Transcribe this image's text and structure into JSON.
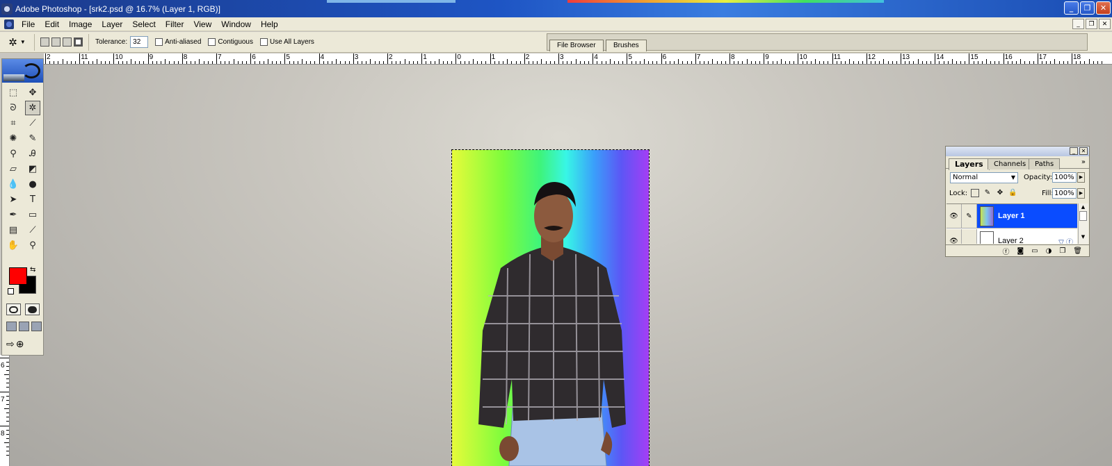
{
  "window": {
    "title": "Adobe Photoshop - [srk2.psd @ 16.7% (Layer 1, RGB)]",
    "controls": [
      "minimize",
      "restore",
      "close"
    ]
  },
  "menu": {
    "items": [
      "File",
      "Edit",
      "Image",
      "Layer",
      "Select",
      "Filter",
      "View",
      "Window",
      "Help"
    ]
  },
  "options": {
    "tool_icon": "magic-wand-icon",
    "tolerance_label": "Tolerance:",
    "tolerance_value": "32",
    "anti_aliased_label": "Anti-aliased",
    "contiguous_label": "Contiguous",
    "use_all_layers_label": "Use All Layers",
    "palette_well_tabs": [
      "File Browser",
      "Brushes"
    ]
  },
  "ruler": {
    "horizontal_labels": [
      "2",
      "11",
      "10",
      "9",
      "8",
      "7",
      "6",
      "5",
      "4",
      "3",
      "2",
      "1",
      "0",
      "1",
      "2",
      "3",
      "4",
      "5",
      "6",
      "7",
      "8",
      "9",
      "10",
      "11",
      "12",
      "13",
      "14",
      "15",
      "16",
      "17",
      "18"
    ],
    "vertical_labels": [
      "6",
      "7",
      "8"
    ]
  },
  "toolbox": {
    "foreground_color": "#ff0000",
    "background_color": "#000000",
    "tools": [
      {
        "name": "rectangular-marquee-tool",
        "glyph": "⬚"
      },
      {
        "name": "move-tool",
        "glyph": "✥"
      },
      {
        "name": "lasso-tool",
        "glyph": "ᘐ"
      },
      {
        "name": "magic-wand-tool",
        "glyph": "✲"
      },
      {
        "name": "crop-tool",
        "glyph": "⌗"
      },
      {
        "name": "slice-tool",
        "glyph": "⟋"
      },
      {
        "name": "healing-brush-tool",
        "glyph": "✺"
      },
      {
        "name": "brush-tool",
        "glyph": "✎"
      },
      {
        "name": "clone-stamp-tool",
        "glyph": "⚲"
      },
      {
        "name": "history-brush-tool",
        "glyph": "Ꭿ"
      },
      {
        "name": "eraser-tool",
        "glyph": "▱"
      },
      {
        "name": "paint-bucket-tool",
        "glyph": "◩"
      },
      {
        "name": "blur-tool",
        "glyph": "💧"
      },
      {
        "name": "dodge-tool",
        "glyph": "●"
      },
      {
        "name": "path-selection-tool",
        "glyph": "➤"
      },
      {
        "name": "type-tool",
        "glyph": "T"
      },
      {
        "name": "pen-tool",
        "glyph": "✒"
      },
      {
        "name": "rectangle-tool",
        "glyph": "▭"
      },
      {
        "name": "notes-tool",
        "glyph": "▤"
      },
      {
        "name": "eyedropper-tool",
        "glyph": "⟋"
      },
      {
        "name": "hand-tool",
        "glyph": "✋"
      },
      {
        "name": "zoom-tool",
        "glyph": "⚲"
      }
    ],
    "active_tool": "magic-wand-tool"
  },
  "layers_panel": {
    "tabs": [
      "Layers",
      "Channels",
      "Paths"
    ],
    "active_tab": "Layers",
    "blend_mode": "Normal",
    "opacity_label": "Opacity:",
    "opacity_value": "100%",
    "lock_label": "Lock:",
    "fill_label": "Fill:",
    "fill_value": "100%",
    "layers": [
      {
        "name": "Layer 1",
        "selected": true
      },
      {
        "name": "Layer 2",
        "selected": false
      }
    ]
  }
}
